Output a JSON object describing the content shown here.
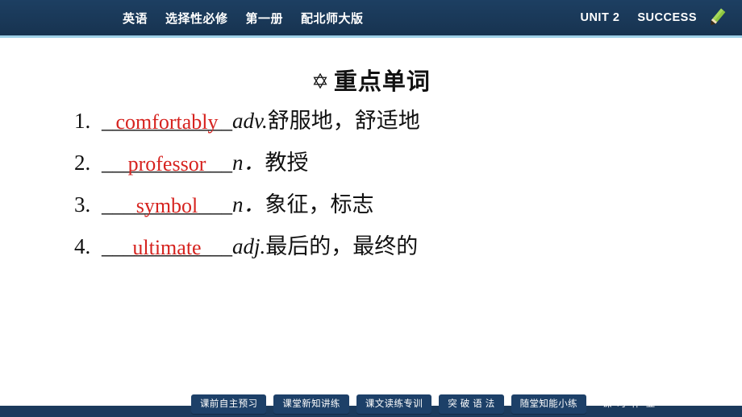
{
  "header": {
    "left_items": [
      "英语",
      "选择性必修",
      "第一册",
      "配北师大版"
    ],
    "unit": "UNIT 2",
    "success": "SUCCESS",
    "pencil_icon": "pencil-icon"
  },
  "section": {
    "bullet_icon": "diamond-bullet-icon",
    "title": "重点单词"
  },
  "words": [
    {
      "num": "1.",
      "blank": "____________",
      "answer": "comfortably",
      "pos": "adv.",
      "meaning": "舒服地，舒适地"
    },
    {
      "num": "2.",
      "blank": "____________",
      "answer": "professor",
      "pos": "n．",
      "meaning": "教授"
    },
    {
      "num": "3.",
      "blank": "____________",
      "answer": "symbol",
      "pos": "n．",
      "meaning": "象征，标志"
    },
    {
      "num": "4.",
      "blank": "____________",
      "answer": "ultimate",
      "pos": "adj.",
      "meaning": "最后的，最终的"
    }
  ],
  "footer": {
    "tabs": [
      {
        "label": "课前自主预习"
      },
      {
        "label": "课堂新知讲练"
      },
      {
        "label": "课文读练专训"
      },
      {
        "label": "突 破 语 法"
      },
      {
        "label": "随堂知能小练"
      },
      {
        "label": "课 时 作 业"
      }
    ]
  }
}
